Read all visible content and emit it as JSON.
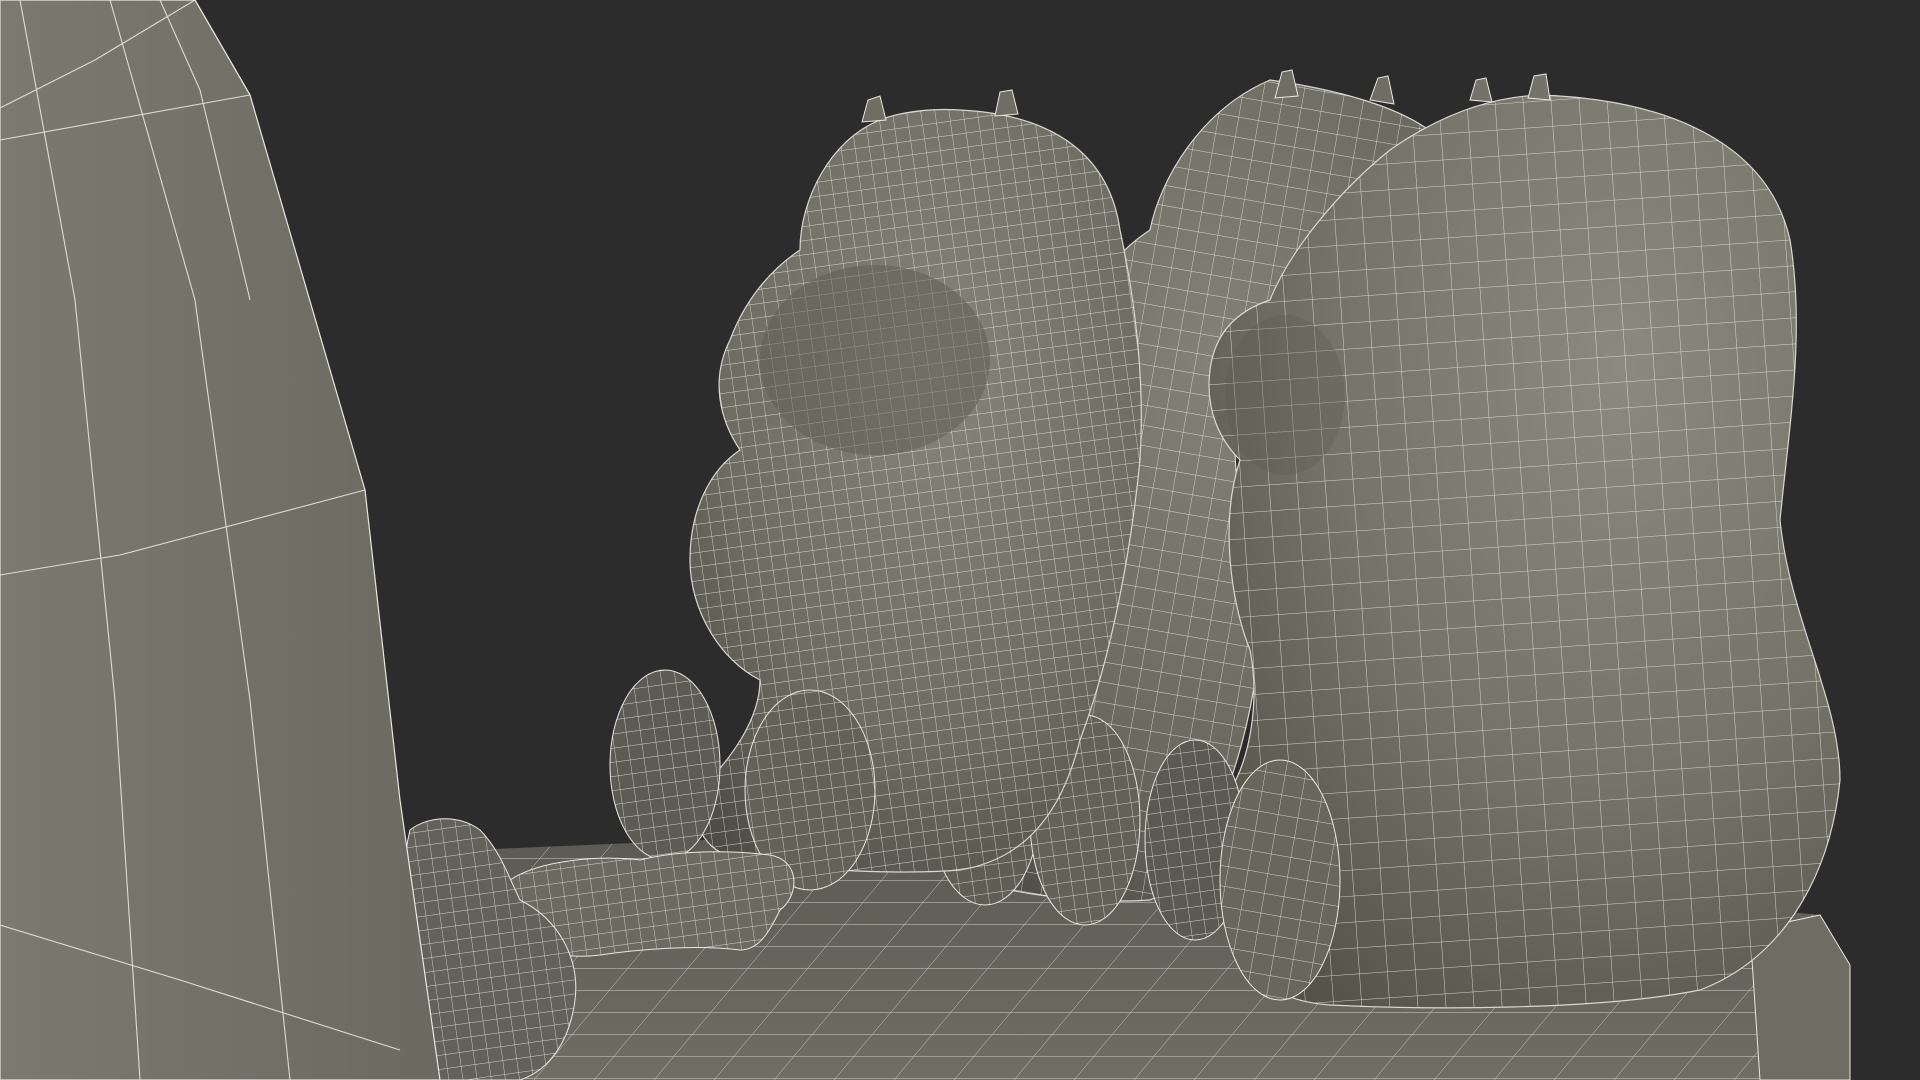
{
  "scene": {
    "background_color": "#2c2c2c",
    "mesh_fill_color": "#77776c",
    "mesh_shadow_color": "#4e4e46",
    "wire_color": "#e8e8e0",
    "objects": [
      "wall-panel",
      "floor-slab",
      "bear-figurine-left",
      "bear-figurine-middle",
      "bear-figurine-right",
      "bone-toy",
      "small-figurine"
    ]
  }
}
